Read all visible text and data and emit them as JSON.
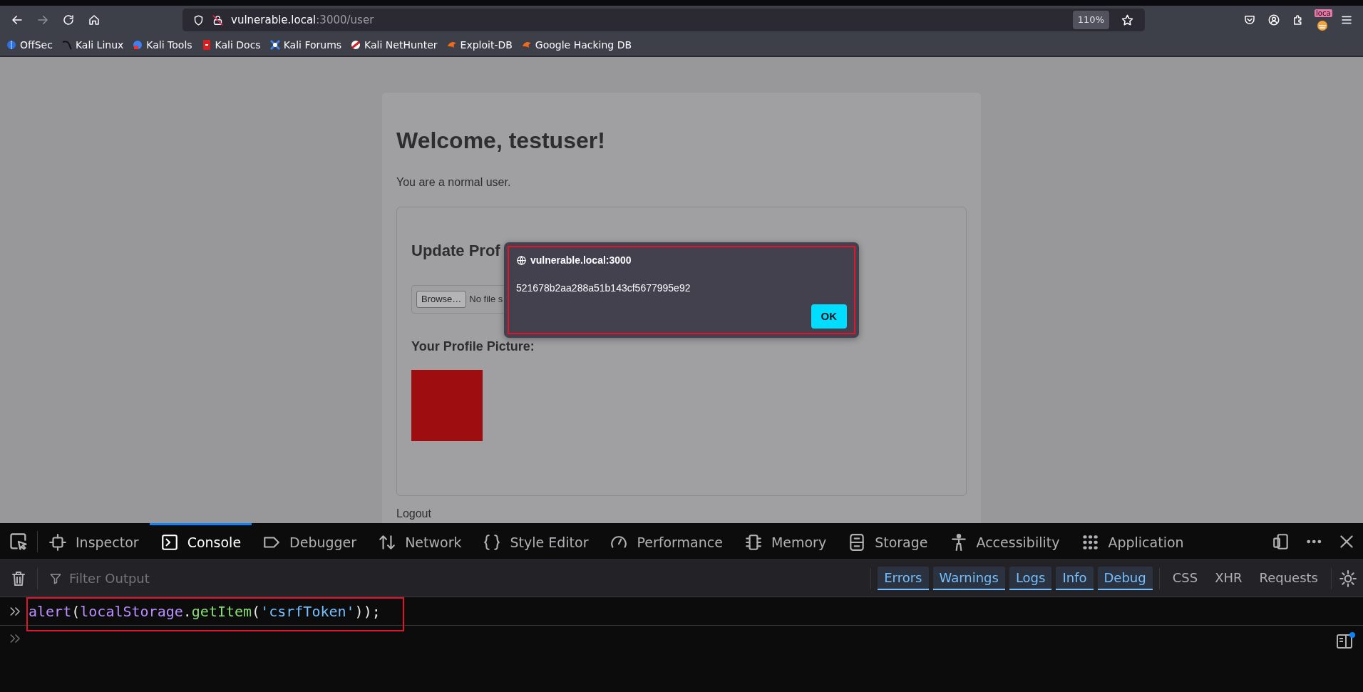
{
  "browser": {
    "nav_buttons": [
      {
        "kind": "back",
        "disabled": false
      },
      {
        "kind": "forward",
        "disabled": true
      },
      {
        "kind": "reload",
        "disabled": false
      },
      {
        "kind": "home",
        "disabled": false
      }
    ],
    "address_bar": {
      "host": "vulnerable.local",
      "path": ":3000/user",
      "zoom": "110%"
    },
    "extension_badge": "loca",
    "bookmarks": [
      {
        "label": "OffSec",
        "kind": "offsec"
      },
      {
        "label": "Kali Linux",
        "kind": "kali"
      },
      {
        "label": "Kali Tools",
        "kind": "tools"
      },
      {
        "label": "Kali Docs",
        "kind": "docs"
      },
      {
        "label": "Kali Forums",
        "kind": "forums"
      },
      {
        "label": "Kali NetHunter",
        "kind": "nethunter"
      },
      {
        "label": "Exploit-DB",
        "kind": "exploit"
      },
      {
        "label": "Google Hacking DB",
        "kind": "exploit"
      }
    ]
  },
  "page": {
    "heading": "Welcome, testuser!",
    "role_text": "You are a normal user.",
    "section_title": "Update Prof",
    "file_button": "Browse…",
    "file_status": "No file s",
    "picture_title": "Your Profile Picture:",
    "logout": "Logout"
  },
  "alert_dialog": {
    "origin": "vulnerable.local:3000",
    "message": "521678b2aa288a51b143cf5677995e92",
    "button": "OK"
  },
  "devtools": {
    "tabs": [
      {
        "label": "Inspector",
        "kind": "inspector",
        "selected": false
      },
      {
        "label": "Console",
        "kind": "console",
        "selected": true
      },
      {
        "label": "Debugger",
        "kind": "debugger",
        "selected": false
      },
      {
        "label": "Network",
        "kind": "network",
        "selected": false
      },
      {
        "label": "Style Editor",
        "kind": "style",
        "selected": false
      },
      {
        "label": "Performance",
        "kind": "performance",
        "selected": false
      },
      {
        "label": "Memory",
        "kind": "memory",
        "selected": false
      },
      {
        "label": "Storage",
        "kind": "storage",
        "selected": false
      },
      {
        "label": "Accessibility",
        "kind": "accessibility",
        "selected": false
      },
      {
        "label": "Application",
        "kind": "application",
        "selected": false
      }
    ],
    "filter": {
      "placeholder": "Filter Output"
    },
    "level_filters": [
      {
        "label": "Errors",
        "selected": true
      },
      {
        "label": "Warnings",
        "selected": true
      },
      {
        "label": "Logs",
        "selected": true
      },
      {
        "label": "Info",
        "selected": true
      },
      {
        "label": "Debug",
        "selected": true
      }
    ],
    "request_filters": [
      {
        "label": "CSS",
        "selected": false
      },
      {
        "label": "XHR",
        "selected": false
      },
      {
        "label": "Requests",
        "selected": false
      }
    ],
    "console_input": "alert(localStorage.getItem('csrfToken'));"
  }
}
